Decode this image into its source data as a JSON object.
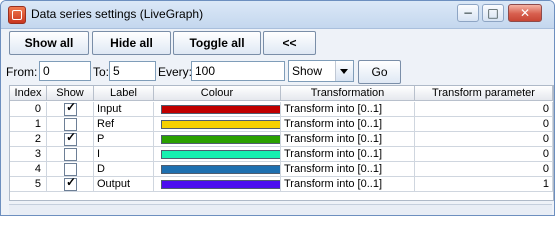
{
  "window": {
    "title": "Data series settings (LiveGraph)",
    "buttons": {
      "minimize": "−",
      "maximize": "□",
      "close": "✕"
    }
  },
  "toolbar": {
    "show_all": "Show all",
    "hide_all": "Hide all",
    "toggle_all": "Toggle all",
    "collapse": "<<"
  },
  "filters": {
    "from_label": "From:",
    "from_value": "0",
    "to_label": "To:",
    "to_value": "5",
    "every_label": "Every:",
    "every_value": "100",
    "show_value": "Show",
    "go": "Go"
  },
  "table": {
    "headers": [
      "Index",
      "Show",
      "Label",
      "Colour",
      "Transformation",
      "Transform parameter"
    ],
    "rows": [
      {
        "index": "0",
        "checked": true,
        "label": "Input",
        "colour": "#c00000",
        "transformation": "Transform into [0..1]",
        "parameter": "0"
      },
      {
        "index": "1",
        "checked": false,
        "label": "Ref",
        "colour": "#f5d000",
        "transformation": "Transform into [0..1]",
        "parameter": "0"
      },
      {
        "index": "2",
        "checked": true,
        "label": "P",
        "colour": "#2aa000",
        "transformation": "Transform into [0..1]",
        "parameter": "0"
      },
      {
        "index": "3",
        "checked": false,
        "label": "I",
        "colour": "#16f0b0",
        "transformation": "Transform into [0..1]",
        "parameter": "0"
      },
      {
        "index": "4",
        "checked": false,
        "label": "D",
        "colour": "#1e70b0",
        "transformation": "Transform into [0..1]",
        "parameter": "0"
      },
      {
        "index": "5",
        "checked": true,
        "label": "Output",
        "colour": "#4b0ff0",
        "transformation": "Transform into [0..1]",
        "parameter": "1"
      }
    ]
  }
}
